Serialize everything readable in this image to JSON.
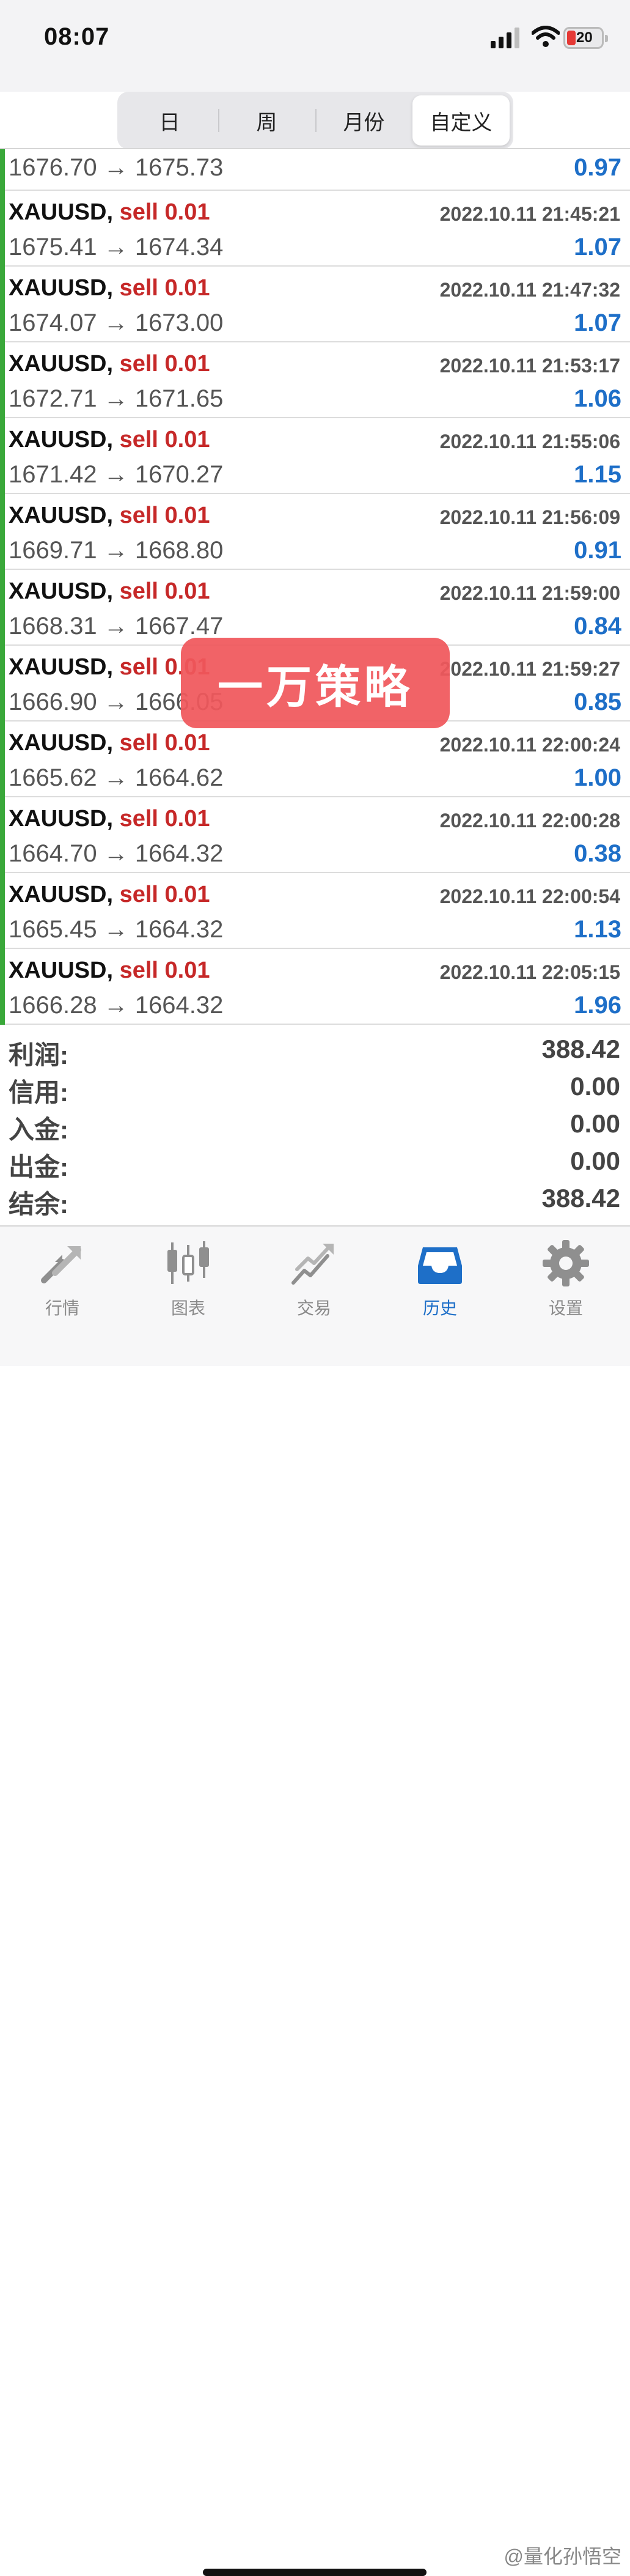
{
  "status": {
    "time": "08:07",
    "battery": "20"
  },
  "segments": [
    "日",
    "周",
    "月份",
    "自定义"
  ],
  "active_segment": "自定义",
  "first_row": {
    "prices": "1676.70 → 1675.73",
    "profit": "0.97"
  },
  "trades": [
    {
      "symbol": "XAUUSD,",
      "side": "sell 0.01",
      "datetime": "2022.10.11 21:45:21",
      "prices": "1675.41 → 1674.34",
      "profit": "1.07"
    },
    {
      "symbol": "XAUUSD,",
      "side": "sell 0.01",
      "datetime": "2022.10.11 21:47:32",
      "prices": "1674.07 → 1673.00",
      "profit": "1.07"
    },
    {
      "symbol": "XAUUSD,",
      "side": "sell 0.01",
      "datetime": "2022.10.11 21:53:17",
      "prices": "1672.71 → 1671.65",
      "profit": "1.06"
    },
    {
      "symbol": "XAUUSD,",
      "side": "sell 0.01",
      "datetime": "2022.10.11 21:55:06",
      "prices": "1671.42 → 1670.27",
      "profit": "1.15"
    },
    {
      "symbol": "XAUUSD,",
      "side": "sell 0.01",
      "datetime": "2022.10.11 21:56:09",
      "prices": "1669.71 → 1668.80",
      "profit": "0.91"
    },
    {
      "symbol": "XAUUSD,",
      "side": "sell 0.01",
      "datetime": "2022.10.11 21:59:00",
      "prices": "1668.31 → 1667.47",
      "profit": "0.84"
    },
    {
      "symbol": "XAUUSD,",
      "side": "sell 0.01",
      "datetime": "2022.10.11 21:59:27",
      "prices": "1666.90 → 1666.05",
      "profit": "0.85"
    },
    {
      "symbol": "XAUUSD,",
      "side": "sell 0.01",
      "datetime": "2022.10.11 22:00:24",
      "prices": "1665.62 → 1664.62",
      "profit": "1.00"
    },
    {
      "symbol": "XAUUSD,",
      "side": "sell 0.01",
      "datetime": "2022.10.11 22:00:28",
      "prices": "1664.70 → 1664.32",
      "profit": "0.38"
    },
    {
      "symbol": "XAUUSD,",
      "side": "sell 0.01",
      "datetime": "2022.10.11 22:00:54",
      "prices": "1665.45 → 1664.32",
      "profit": "1.13"
    },
    {
      "symbol": "XAUUSD,",
      "side": "sell 0.01",
      "datetime": "2022.10.11 22:05:15",
      "prices": "1666.28 → 1664.32",
      "profit": "1.96"
    }
  ],
  "summary": [
    {
      "label": "利润:",
      "value": "388.42"
    },
    {
      "label": "信用:",
      "value": "0.00"
    },
    {
      "label": "入金:",
      "value": "0.00"
    },
    {
      "label": "出金:",
      "value": "0.00"
    },
    {
      "label": "结余:",
      "value": "388.42"
    }
  ],
  "overlay_badge": "一万策略",
  "tabs": [
    {
      "label": "行情",
      "icon": "quotes-arrows-icon"
    },
    {
      "label": "图表",
      "icon": "candlestick-chart-icon"
    },
    {
      "label": "交易",
      "icon": "trade-trend-icon"
    },
    {
      "label": "历史",
      "icon": "history-inbox-icon"
    },
    {
      "label": "设置",
      "icon": "settings-gear-icon"
    }
  ],
  "active_tab": "历史",
  "credit": "@量化孙悟空",
  "colors": {
    "accent": "#1e6fc8",
    "sell": "#c62828",
    "bar": "#3aa83a",
    "badge": "#f0585c"
  }
}
